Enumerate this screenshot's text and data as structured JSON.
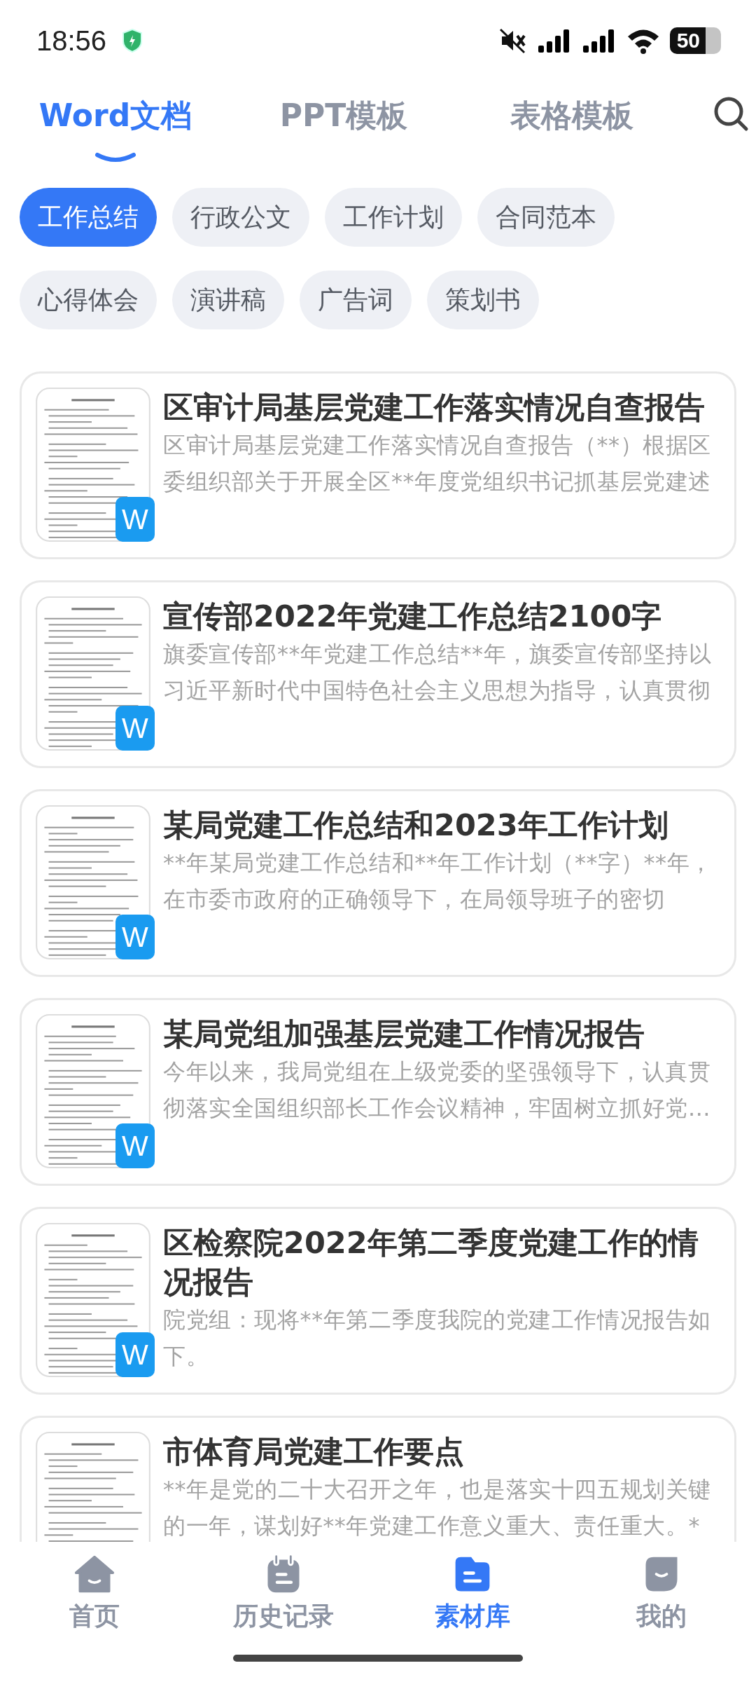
{
  "status_bar": {
    "time": "18:56",
    "battery": "50"
  },
  "tabs": [
    {
      "label": "Word文档",
      "selected": true
    },
    {
      "label": "PPT模板",
      "selected": false
    },
    {
      "label": "表格模板",
      "selected": false
    }
  ],
  "categories": [
    {
      "label": "工作总结",
      "selected": true
    },
    {
      "label": "行政公文",
      "selected": false
    },
    {
      "label": "工作计划",
      "selected": false
    },
    {
      "label": "合同范本",
      "selected": false
    },
    {
      "label": "心得体会",
      "selected": false
    },
    {
      "label": "演讲稿",
      "selected": false
    },
    {
      "label": "广告词",
      "selected": false
    },
    {
      "label": "策划书",
      "selected": false
    }
  ],
  "documents": [
    {
      "title": "区审计局基层党建工作落实情况自查报告",
      "summary": "区审计局基层党建工作落实情况自查报告（**）根据区委组织部关于开展全区**年度党组织书记抓基层党建述",
      "badge": "W"
    },
    {
      "title": "宣传部2022年党建工作总结2100字",
      "summary": "旗委宣传部**年党建工作总结**年，旗委宣传部坚持以习近平新时代中国特色社会主义思想为指导，认真贯彻",
      "badge": "W"
    },
    {
      "title": "某局党建工作总结和2023年工作计划",
      "summary": "**年某局党建工作总结和**年工作计划（**字）**年，在市委市政府的正确领导下，在局领导班子的密切",
      "badge": "W"
    },
    {
      "title": "某局党组加强基层党建工作情况报告",
      "summary": "今年以来，我局党组在上级党委的坚强领导下，认真贯彻落实全国组织部长工作会议精神，牢固树立抓好党…",
      "badge": "W"
    },
    {
      "title": "区检察院2022年第二季度党建工作的情况报告",
      "summary": "院党组：现将**年第二季度我院的党建工作情况报告如下。",
      "badge": "W"
    },
    {
      "title": "市体育局党建工作要点",
      "summary": "**年是党的二十大召开之年，也是落实十四五规划关键的一年，谋划好**年党建工作意义重大、责任重大。*"
    }
  ],
  "nav": [
    {
      "label": "首页",
      "kind": "home",
      "selected": false
    },
    {
      "label": "历史记录",
      "kind": "history",
      "selected": false
    },
    {
      "label": "素材库",
      "kind": "library",
      "selected": true
    },
    {
      "label": "我的",
      "kind": "profile",
      "selected": false
    }
  ]
}
